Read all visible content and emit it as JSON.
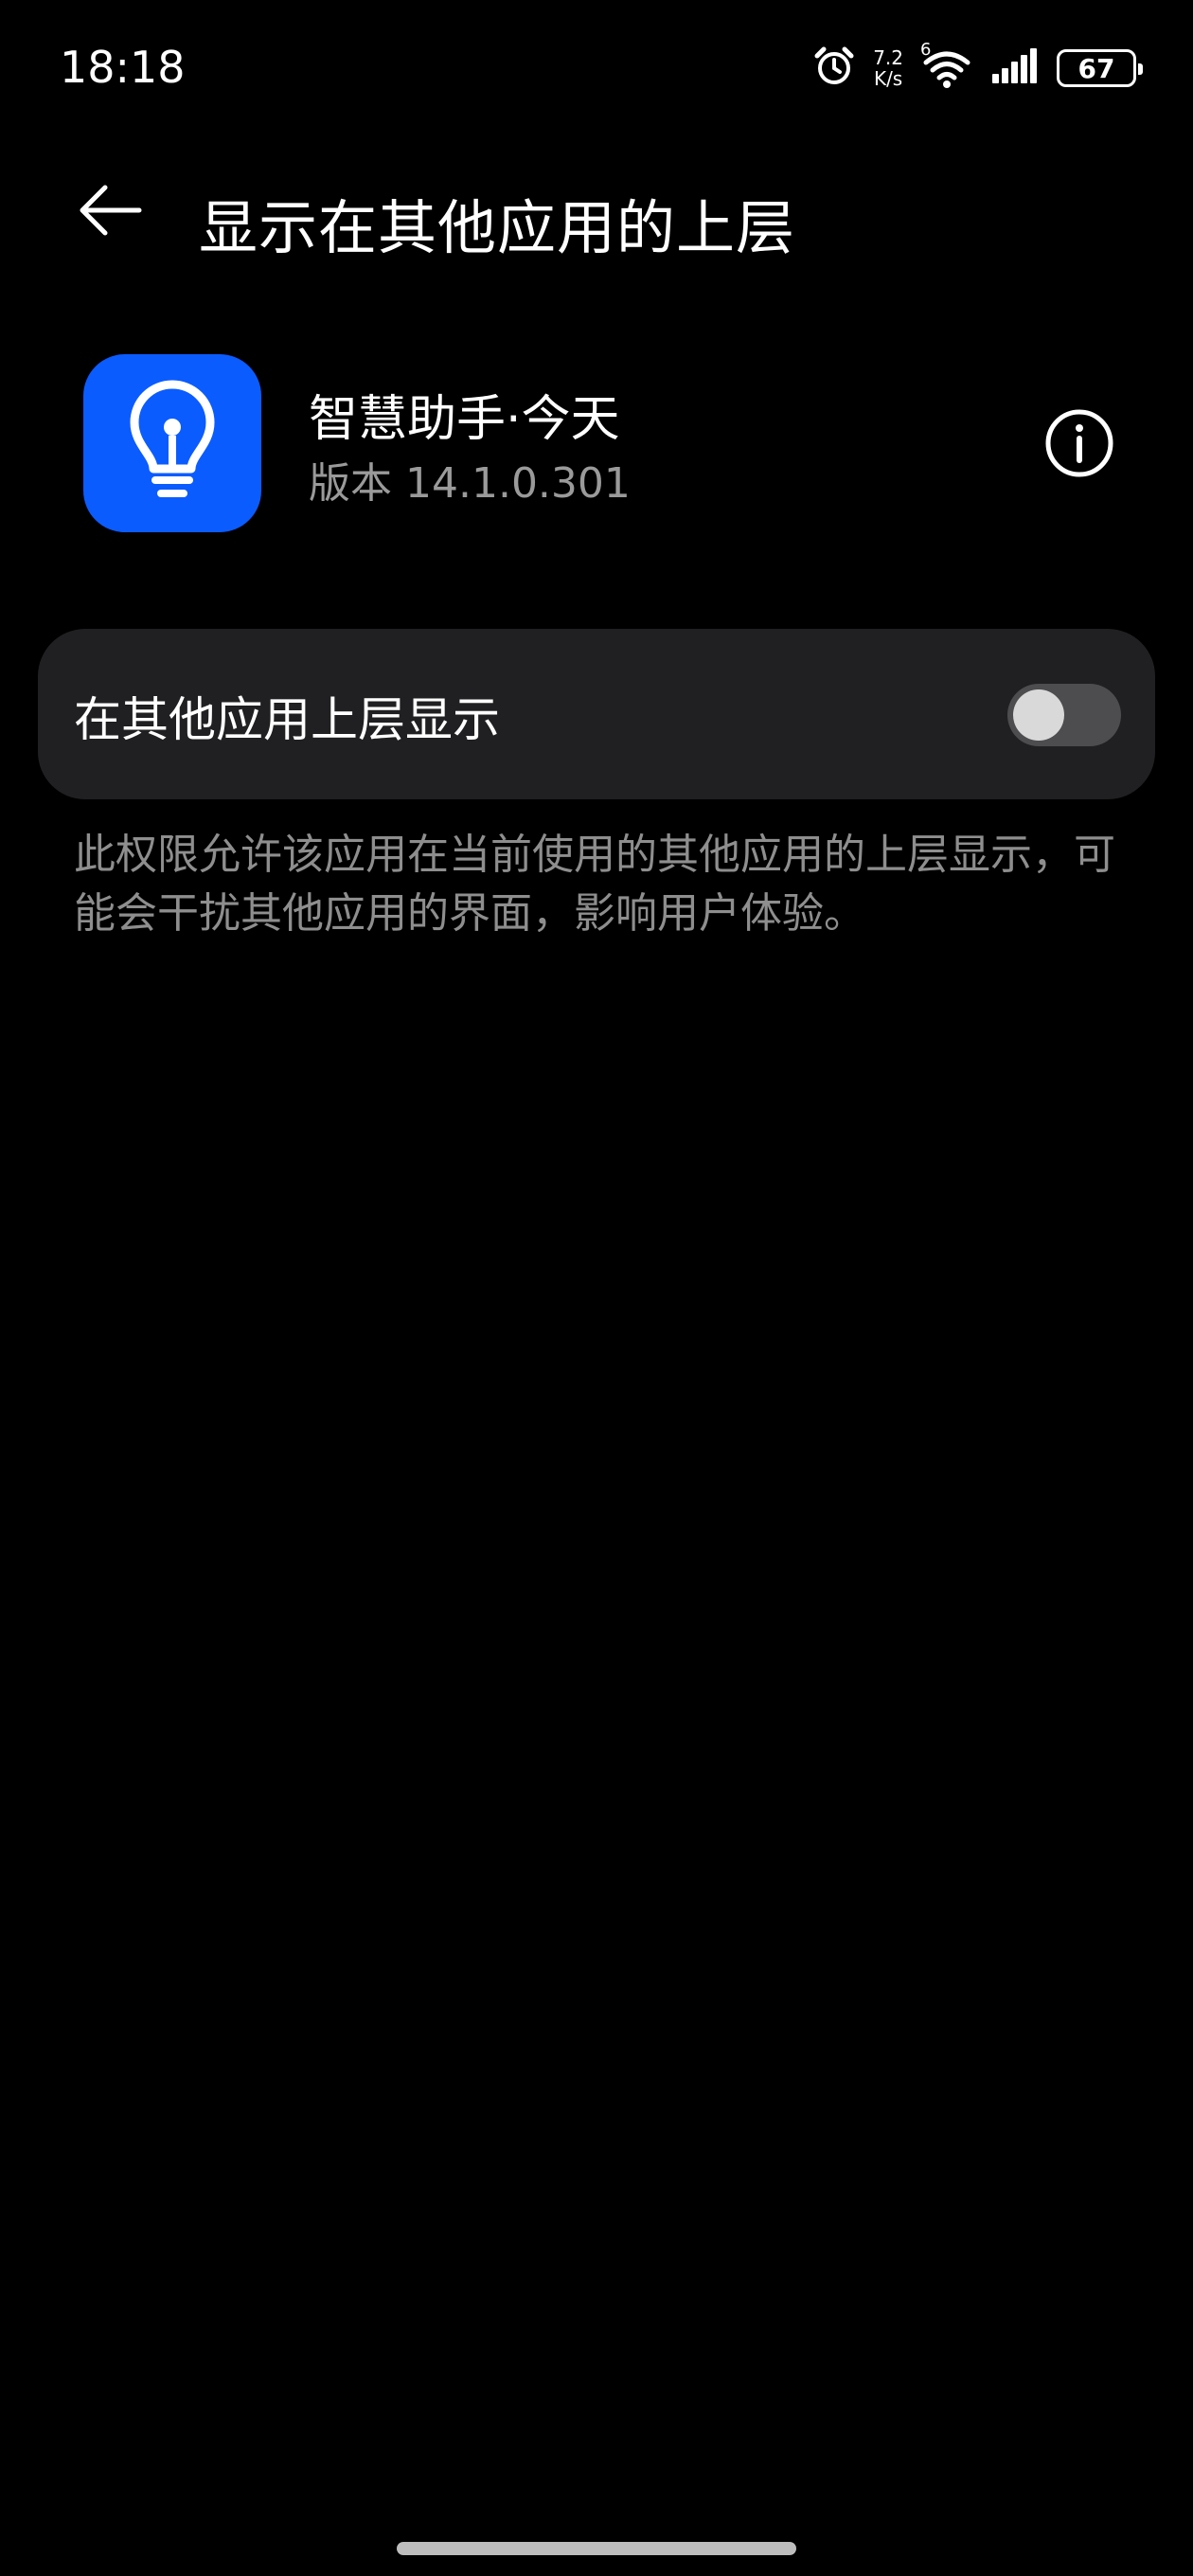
{
  "status_bar": {
    "time": "18:18",
    "net_speed_value": "7.2",
    "net_speed_unit": "K/s",
    "network_type": "6",
    "battery_level": "67"
  },
  "app_bar": {
    "title": "显示在其他应用的上层"
  },
  "app": {
    "name": "智慧助手·今天",
    "version": "版本 14.1.0.301",
    "icon": "lightbulb-icon",
    "icon_color": "#0b5cff"
  },
  "setting": {
    "label": "在其他应用上层显示",
    "enabled": false
  },
  "description": "此权限允许该应用在当前使用的其他应用的上层显示，可能会干扰其他应用的界面，影响用户体验。"
}
